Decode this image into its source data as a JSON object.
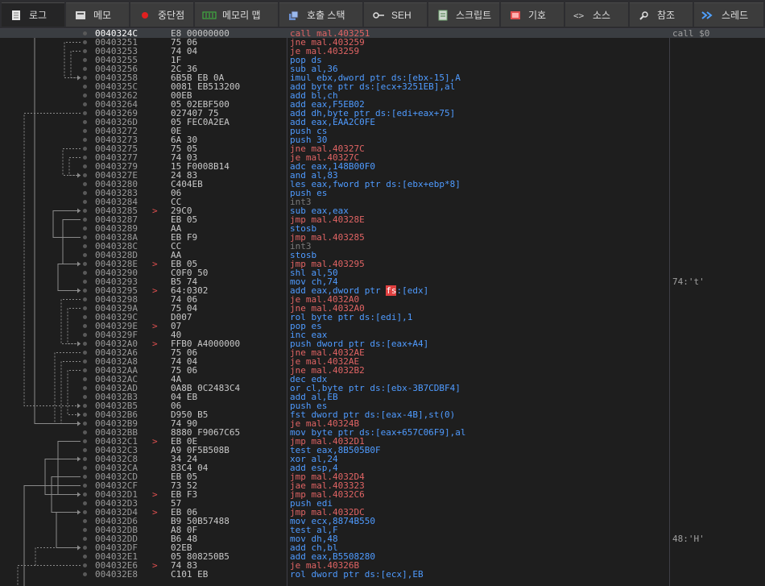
{
  "tabs": [
    {
      "label": "로그",
      "icon": "log-icon",
      "active": true
    },
    {
      "label": "메모",
      "icon": "notes-icon"
    },
    {
      "label": "중단점",
      "icon": "breakpoint-icon"
    },
    {
      "label": "메모리 맵",
      "icon": "memory-map-icon"
    },
    {
      "label": "호출 스택",
      "icon": "call-stack-icon"
    },
    {
      "label": "SEH",
      "icon": "seh-icon"
    },
    {
      "label": "스크립트",
      "icon": "script-icon"
    },
    {
      "label": "기호",
      "icon": "symbols-icon"
    },
    {
      "label": "소스",
      "icon": "source-icon"
    },
    {
      "label": "참조",
      "icon": "references-icon"
    },
    {
      "label": "스레드",
      "icon": "threads-icon"
    }
  ],
  "colors": {
    "instruction": "#4f9bff",
    "jump": "#e06464",
    "bytes": "#c8c8c8",
    "address": "#9a9a9a",
    "segment_highlight": "#e04040"
  },
  "rows": [
    {
      "addr": "0040324C",
      "mark": "",
      "bytes": "E8 00000000",
      "instr": "call mal.403251",
      "kind": "jmp",
      "comment": "call $0"
    },
    {
      "addr": "00403251",
      "mark": "",
      "bytes": "75 06",
      "instr": "jne mal.403259",
      "kind": "jmp",
      "comment": ""
    },
    {
      "addr": "00403253",
      "mark": "",
      "bytes": "74 04",
      "instr": "je mal.403259",
      "kind": "jmp",
      "comment": ""
    },
    {
      "addr": "00403255",
      "mark": "",
      "bytes": "1F",
      "instr": "pop ds",
      "kind": "",
      "comment": ""
    },
    {
      "addr": "00403256",
      "mark": "",
      "bytes": "2C 36",
      "instr": "sub al,36",
      "kind": "",
      "comment": ""
    },
    {
      "addr": "00403258",
      "mark": "",
      "bytes": "6B5B EB 0A",
      "instr": "imul ebx,dword ptr ds:[ebx-15],A",
      "kind": "",
      "comment": ""
    },
    {
      "addr": "0040325C",
      "mark": "",
      "bytes": "0081 EB513200",
      "instr": "add byte ptr ds:[ecx+3251EB],al",
      "kind": "",
      "comment": ""
    },
    {
      "addr": "00403262",
      "mark": "",
      "bytes": "00EB",
      "instr": "add bl,ch",
      "kind": "",
      "comment": ""
    },
    {
      "addr": "00403264",
      "mark": "",
      "bytes": "05 02EBF500",
      "instr": "add eax,F5EB02",
      "kind": "",
      "comment": ""
    },
    {
      "addr": "00403269",
      "mark": "",
      "bytes": "027407 75",
      "instr": "add dh,byte ptr ds:[edi+eax+75]",
      "kind": "",
      "comment": ""
    },
    {
      "addr": "0040326D",
      "mark": "",
      "bytes": "05 FEC0A2EA",
      "instr": "add eax,EAA2C0FE",
      "kind": "",
      "comment": ""
    },
    {
      "addr": "00403272",
      "mark": "",
      "bytes": "0E",
      "instr": "push cs",
      "kind": "",
      "comment": ""
    },
    {
      "addr": "00403273",
      "mark": "",
      "bytes": "6A 30",
      "instr": "push 30",
      "kind": "",
      "comment": ""
    },
    {
      "addr": "00403275",
      "mark": "",
      "bytes": "75 05",
      "instr": "jne mal.40327C",
      "kind": "jmp",
      "comment": ""
    },
    {
      "addr": "00403277",
      "mark": "",
      "bytes": "74 03",
      "instr": "je mal.40327C",
      "kind": "jmp",
      "comment": ""
    },
    {
      "addr": "00403279",
      "mark": "",
      "bytes": "15 F0008B14",
      "instr": "adc eax,148B00F0",
      "kind": "",
      "comment": ""
    },
    {
      "addr": "0040327E",
      "mark": "",
      "bytes": "24 83",
      "instr": "and al,83",
      "kind": "",
      "comment": ""
    },
    {
      "addr": "00403280",
      "mark": "",
      "bytes": "C404EB",
      "instr": "les eax,fword ptr ds:[ebx+ebp*8]",
      "kind": "",
      "comment": ""
    },
    {
      "addr": "00403283",
      "mark": "",
      "bytes": "06",
      "instr": "push es",
      "kind": "",
      "comment": ""
    },
    {
      "addr": "00403284",
      "mark": "",
      "bytes": "CC",
      "instr": "int3",
      "kind": "int3",
      "comment": ""
    },
    {
      "addr": "00403285",
      "mark": ">",
      "bytes": "29C0",
      "instr": "sub eax,eax",
      "kind": "",
      "comment": ""
    },
    {
      "addr": "00403287",
      "mark": "",
      "bytes": "EB 05",
      "instr": "jmp mal.40328E",
      "kind": "jmp",
      "comment": ""
    },
    {
      "addr": "00403289",
      "mark": "",
      "bytes": "AA",
      "instr": "stosb",
      "kind": "",
      "comment": ""
    },
    {
      "addr": "0040328A",
      "mark": "",
      "bytes": "EB F9",
      "instr": "jmp mal.403285",
      "kind": "jmp",
      "comment": ""
    },
    {
      "addr": "0040328C",
      "mark": "",
      "bytes": "CC",
      "instr": "int3",
      "kind": "int3",
      "comment": ""
    },
    {
      "addr": "0040328D",
      "mark": "",
      "bytes": "AA",
      "instr": "stosb",
      "kind": "",
      "comment": ""
    },
    {
      "addr": "0040328E",
      "mark": ">",
      "bytes": "EB 05",
      "instr": "jmp mal.403295",
      "kind": "jmp",
      "comment": ""
    },
    {
      "addr": "00403290",
      "mark": "",
      "bytes": "C0F0 50",
      "instr": "shl al,50",
      "kind": "",
      "comment": ""
    },
    {
      "addr": "00403293",
      "mark": "",
      "bytes": "B5 74",
      "instr": "mov ch,74",
      "kind": "",
      "comment": "74:'t'"
    },
    {
      "addr": "00403295",
      "mark": ">",
      "bytes": "64:0302",
      "instr": "add eax,dword ptr fs:[edx]",
      "kind": "fs",
      "comment": ""
    },
    {
      "addr": "00403298",
      "mark": "",
      "bytes": "74 06",
      "instr": "je mal.4032A0",
      "kind": "jmp",
      "comment": ""
    },
    {
      "addr": "0040329A",
      "mark": "",
      "bytes": "75 04",
      "instr": "jne mal.4032A0",
      "kind": "jmp",
      "comment": ""
    },
    {
      "addr": "0040329C",
      "mark": "",
      "bytes": "D007",
      "instr": "rol byte ptr ds:[edi],1",
      "kind": "",
      "comment": ""
    },
    {
      "addr": "0040329E",
      "mark": ">",
      "bytes": "07",
      "instr": "pop es",
      "kind": "",
      "comment": ""
    },
    {
      "addr": "0040329F",
      "mark": "",
      "bytes": "40",
      "instr": "inc eax",
      "kind": "",
      "comment": ""
    },
    {
      "addr": "004032A0",
      "mark": ">",
      "bytes": "FFB0 A4000000",
      "instr": "push dword ptr ds:[eax+A4]",
      "kind": "",
      "comment": ""
    },
    {
      "addr": "004032A6",
      "mark": "",
      "bytes": "75 06",
      "instr": "jne mal.4032AE",
      "kind": "jmp",
      "comment": ""
    },
    {
      "addr": "004032A8",
      "mark": "",
      "bytes": "74 04",
      "instr": "je mal.4032AE",
      "kind": "jmp",
      "comment": ""
    },
    {
      "addr": "004032AA",
      "mark": "",
      "bytes": "75 06",
      "instr": "jne mal.4032B2",
      "kind": "jmp",
      "comment": ""
    },
    {
      "addr": "004032AC",
      "mark": "",
      "bytes": "4A",
      "instr": "dec edx",
      "kind": "",
      "comment": ""
    },
    {
      "addr": "004032AD",
      "mark": "",
      "bytes": "0A8B 0C2483C4",
      "instr": "or cl,byte ptr ds:[ebx-3B7CDBF4]",
      "kind": "",
      "comment": ""
    },
    {
      "addr": "004032B3",
      "mark": "",
      "bytes": "04 EB",
      "instr": "add al,EB",
      "kind": "",
      "comment": ""
    },
    {
      "addr": "004032B5",
      "mark": "",
      "bytes": "06",
      "instr": "push es",
      "kind": "",
      "comment": ""
    },
    {
      "addr": "004032B6",
      "mark": "",
      "bytes": "D950 B5",
      "instr": "fst dword ptr ds:[eax-4B],st(0)",
      "kind": "",
      "comment": ""
    },
    {
      "addr": "004032B9",
      "mark": "",
      "bytes": "74 90",
      "instr": "je mal.40324B",
      "kind": "jmp",
      "comment": ""
    },
    {
      "addr": "004032BB",
      "mark": "",
      "bytes": "8880 F9067C65",
      "instr": "mov byte ptr ds:[eax+657C06F9],al",
      "kind": "",
      "comment": ""
    },
    {
      "addr": "004032C1",
      "mark": ">",
      "bytes": "EB 0E",
      "instr": "jmp mal.4032D1",
      "kind": "jmp",
      "comment": ""
    },
    {
      "addr": "004032C3",
      "mark": "",
      "bytes": "A9 0F5B508B",
      "instr": "test eax,8B505B0F",
      "kind": "",
      "comment": ""
    },
    {
      "addr": "004032C8",
      "mark": "",
      "bytes": "34 24",
      "instr": "xor al,24",
      "kind": "",
      "comment": ""
    },
    {
      "addr": "004032CA",
      "mark": "",
      "bytes": "83C4 04",
      "instr": "add esp,4",
      "kind": "",
      "comment": ""
    },
    {
      "addr": "004032CD",
      "mark": "",
      "bytes": "EB 05",
      "instr": "jmp mal.4032D4",
      "kind": "jmp",
      "comment": ""
    },
    {
      "addr": "004032CF",
      "mark": "",
      "bytes": "73 52",
      "instr": "jae mal.403323",
      "kind": "jmp",
      "comment": ""
    },
    {
      "addr": "004032D1",
      "mark": ">",
      "bytes": "EB F3",
      "instr": "jmp mal.4032C6",
      "kind": "jmp",
      "comment": ""
    },
    {
      "addr": "004032D3",
      "mark": "",
      "bytes": "57",
      "instr": "push edi",
      "kind": "",
      "comment": ""
    },
    {
      "addr": "004032D4",
      "mark": ">",
      "bytes": "EB 06",
      "instr": "jmp mal.4032DC",
      "kind": "jmp",
      "comment": ""
    },
    {
      "addr": "004032D6",
      "mark": "",
      "bytes": "B9 50B57488",
      "instr": "mov ecx,8874B550",
      "kind": "",
      "comment": ""
    },
    {
      "addr": "004032DB",
      "mark": "",
      "bytes": "A8 0F",
      "instr": "test al,F",
      "kind": "",
      "comment": ""
    },
    {
      "addr": "004032DD",
      "mark": "",
      "bytes": "B6 48",
      "instr": "mov dh,48",
      "kind": "",
      "comment": "48:'H'"
    },
    {
      "addr": "004032DF",
      "mark": "",
      "bytes": "02EB",
      "instr": "add ch,bl",
      "kind": "",
      "comment": ""
    },
    {
      "addr": "004032E1",
      "mark": "",
      "bytes": "05 808250B5",
      "instr": "add eax,B5508280",
      "kind": "",
      "comment": ""
    },
    {
      "addr": "004032E6",
      "mark": ">",
      "bytes": "74 83",
      "instr": "je mal.40326B",
      "kind": "jmp",
      "comment": ""
    },
    {
      "addr": "004032E8",
      "mark": "",
      "bytes": "C101 EB",
      "instr": "rol dword ptr ds:[ecx],EB",
      "kind": "",
      "comment": ""
    }
  ]
}
